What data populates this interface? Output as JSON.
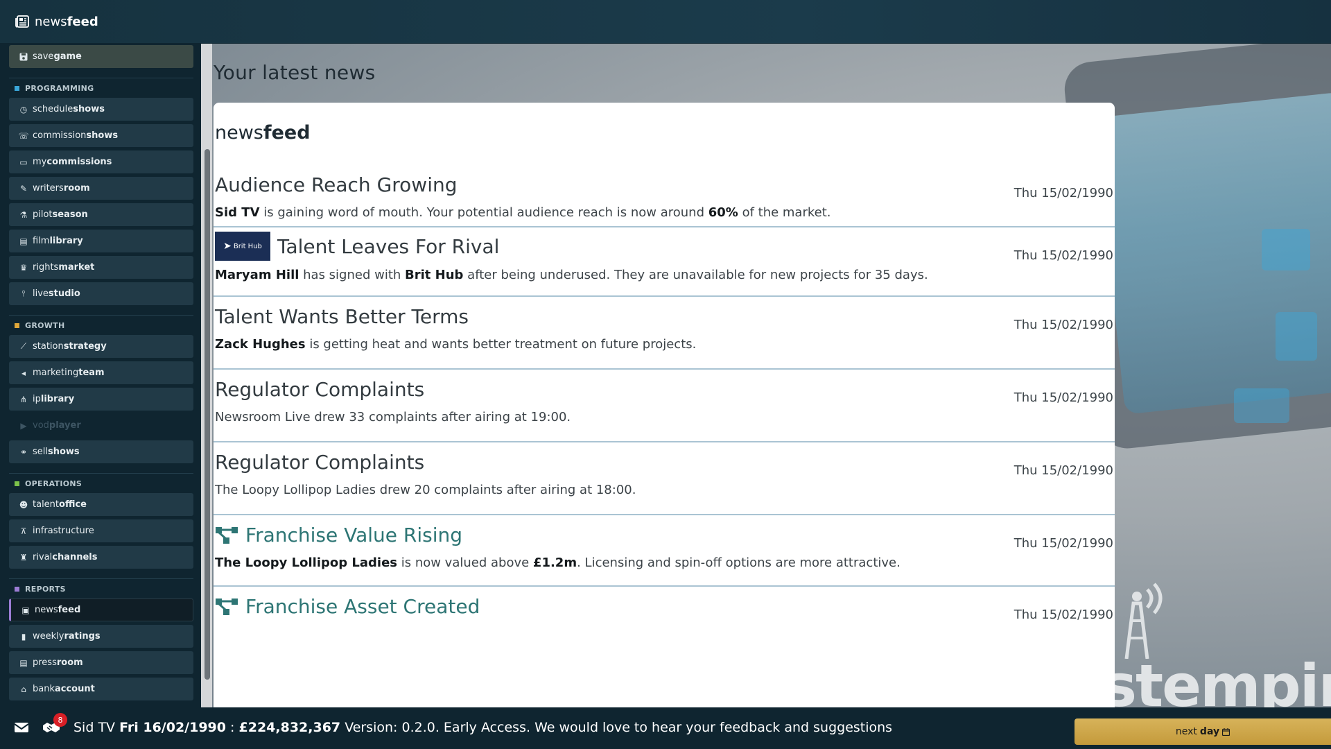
{
  "app": {
    "title_light": "news",
    "title_bold": "feed"
  },
  "sidebar": {
    "savegame": {
      "light": "save",
      "bold": "game"
    },
    "sections": [
      {
        "name": "PROGRAMMING",
        "color": "#3aa7d9",
        "items": [
          {
            "light": "schedule",
            "bold": "shows",
            "icon": "clock-icon"
          },
          {
            "light": "commission",
            "bold": "shows",
            "icon": "phone-icon"
          },
          {
            "light": "my",
            "bold": "commissions",
            "icon": "monitor-icon"
          },
          {
            "light": "writers",
            "bold": "room",
            "icon": "pen-icon"
          },
          {
            "light": "pilot",
            "bold": "season",
            "icon": "flask-icon"
          },
          {
            "light": "film",
            "bold": "library",
            "icon": "film-icon"
          },
          {
            "light": "rights",
            "bold": "market",
            "icon": "trophy-icon"
          },
          {
            "light": "live",
            "bold": "studio",
            "icon": "broadcast-icon"
          }
        ]
      },
      {
        "name": "GROWTH",
        "color": "#e0a83a",
        "items": [
          {
            "light": "station",
            "bold": "strategy",
            "icon": "chart-line-icon"
          },
          {
            "light": "marketing",
            "bold": "team",
            "icon": "megaphone-icon"
          },
          {
            "light": "ip",
            "bold": "library",
            "icon": "network-icon"
          },
          {
            "light": "vod",
            "bold": "player",
            "icon": "play-icon",
            "disabled": true
          },
          {
            "light": "sell",
            "bold": "shows",
            "icon": "handshake-icon"
          }
        ]
      },
      {
        "name": "OPERATIONS",
        "color": "#7cc24a",
        "items": [
          {
            "light": "talent",
            "bold": "office",
            "icon": "people-icon"
          },
          {
            "light": "infrastructure",
            "bold": "",
            "icon": "tower-icon"
          },
          {
            "light": "rival",
            "bold": "channels",
            "icon": "chess-icon"
          }
        ]
      },
      {
        "name": "REPORTS",
        "color": "#9c7cd4",
        "items": [
          {
            "light": "news",
            "bold": "feed",
            "icon": "newspaper-icon",
            "active": true
          },
          {
            "light": "weekly",
            "bold": "ratings",
            "icon": "bars-icon"
          },
          {
            "light": "press",
            "bold": "room",
            "icon": "press-icon"
          },
          {
            "light": "bank",
            "bold": "account",
            "icon": "bank-icon"
          }
        ]
      }
    ]
  },
  "main": {
    "heading": "Your latest news",
    "panel_title_light": "news",
    "panel_title_bold": "feed",
    "items": [
      {
        "title": "Audience Reach Growing",
        "date": "Thu 15/02/1990",
        "body": [
          {
            "b": "Sid TV"
          },
          {
            "t": " is gaining word of mouth. Your potential audience reach is now around "
          },
          {
            "b": "60%"
          },
          {
            "t": " of the market."
          }
        ]
      },
      {
        "title": "Talent Leaves For Rival",
        "date": "Thu 15/02/1990",
        "logo": "Brit Hub",
        "body": [
          {
            "b": "Maryam Hill"
          },
          {
            "t": " has signed with "
          },
          {
            "b": "Brit Hub"
          },
          {
            "t": " after being underused. They are unavailable for new projects for 35 days."
          }
        ]
      },
      {
        "title": "Talent Wants Better Terms",
        "date": "Thu 15/02/1990",
        "body": [
          {
            "b": "Zack Hughes"
          },
          {
            "t": " is getting heat and wants better treatment on future projects."
          }
        ]
      },
      {
        "title": "Regulator Complaints",
        "date": "Thu 15/02/1990",
        "body": [
          {
            "t": "Newsroom Live drew 33 complaints after airing at 19:00."
          }
        ]
      },
      {
        "title": "Regulator Complaints",
        "date": "Thu 15/02/1990",
        "body": [
          {
            "t": "The Loopy Lollipop Ladies drew 20 complaints after airing at 18:00."
          }
        ]
      },
      {
        "title": "Franchise Value Rising",
        "date": "Thu 15/02/1990",
        "ip": true,
        "body": [
          {
            "b": "The Loopy Lollipop Ladies"
          },
          {
            "t": " is now valued above "
          },
          {
            "b": "£1.2m"
          },
          {
            "t": ". Licensing and spin-off options are more attractive."
          }
        ]
      },
      {
        "title": "Franchise Asset Created",
        "date": "Thu 15/02/1990",
        "ip": true,
        "body": []
      }
    ]
  },
  "bottombar": {
    "badge": "8",
    "channel": "Sid TV",
    "date": "Fri 16/02/1990",
    "sep": ":",
    "money": "£224,832,367",
    "version": "Version: 0.2.0. Early Access. We would love to hear your feedback and suggestions",
    "nextday_light": "next",
    "nextday_bold": "day"
  },
  "background": {
    "logo_text": "stempire"
  }
}
